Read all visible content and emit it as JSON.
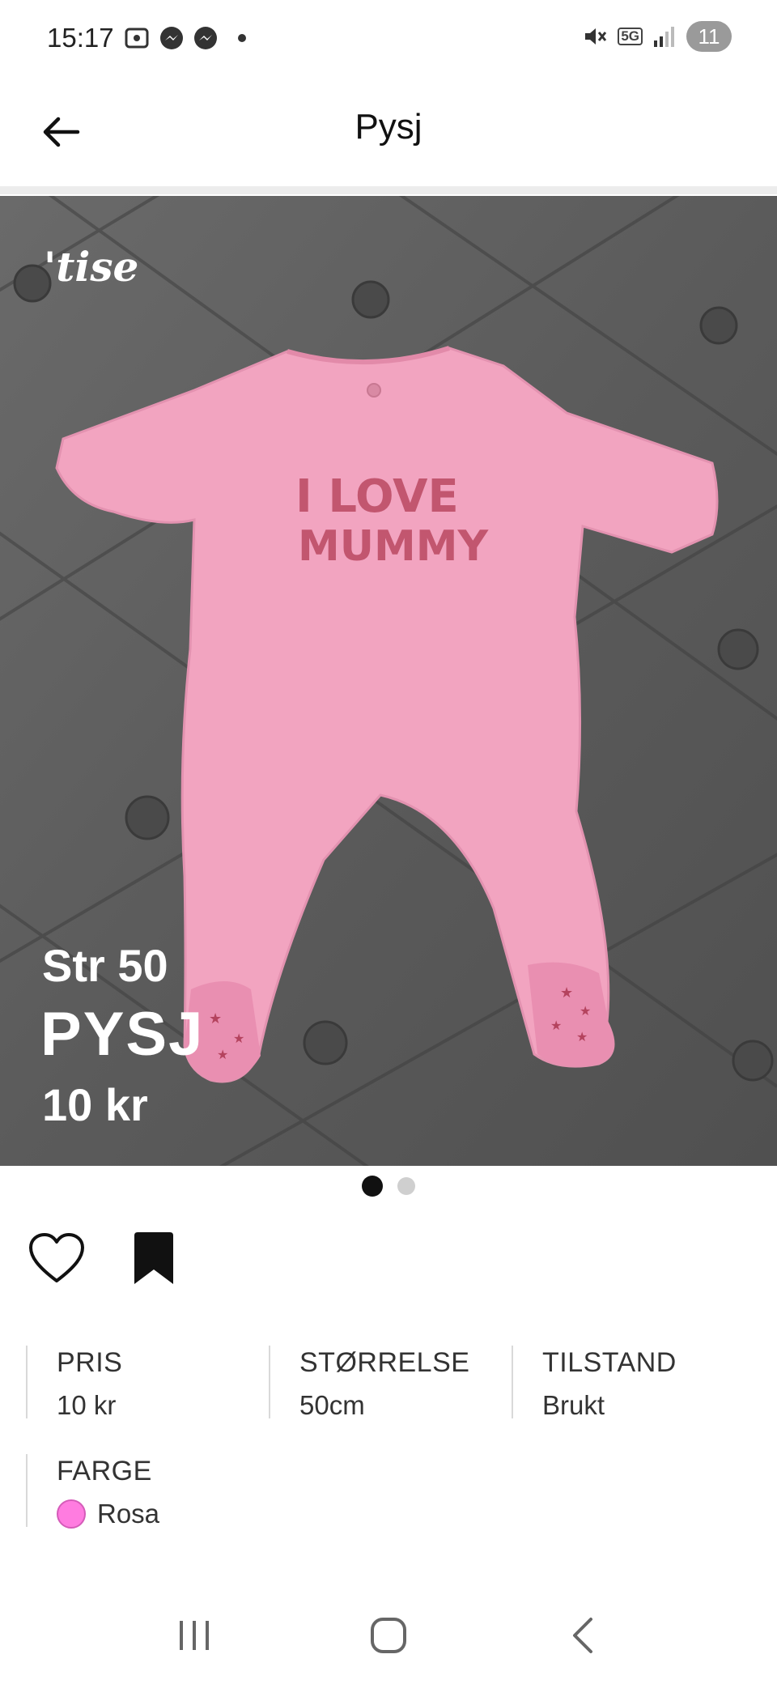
{
  "status_bar": {
    "time": "15:17",
    "network": "5G",
    "notification_count": "11"
  },
  "header": {
    "title": "Pysj"
  },
  "listing": {
    "brand_watermark": "'tise",
    "overlay_size": "Str 50",
    "overlay_name": "PYSJ",
    "overlay_price": "10 kr",
    "garment_print_line1": "I LOVE",
    "garment_print_line2": "MUMMY",
    "image_count": 2,
    "active_image": 1
  },
  "details": {
    "price_label": "PRIS",
    "price_value": "10 kr",
    "size_label": "STØRRELSE",
    "size_value": "50cm",
    "condition_label": "TILSTAND",
    "condition_value": "Brukt",
    "color_label": "FARGE",
    "color_value": "Rosa",
    "color_swatch": "#ff7ce0"
  },
  "icons": {
    "back": "arrow-left-icon",
    "like": "heart-outline-icon",
    "save": "bookmark-icon",
    "nav_recent": "recent-apps-icon",
    "nav_home": "home-icon",
    "nav_back": "chevron-left-icon"
  }
}
